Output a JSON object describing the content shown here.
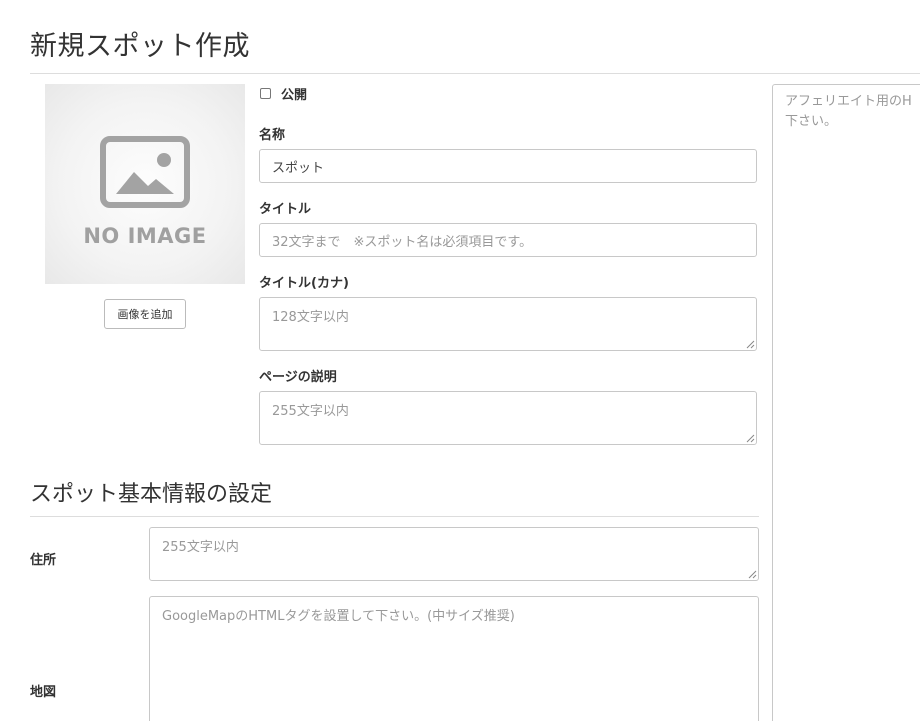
{
  "page": {
    "title": "新規スポット作成"
  },
  "image": {
    "placeholder_text": "NO IMAGE",
    "add_button_label": "画像を追加"
  },
  "form": {
    "publish_label": "公開",
    "publish_checked": false,
    "name": {
      "label": "名称",
      "value": "スポット"
    },
    "title": {
      "label": "タイトル",
      "placeholder": "32文字まで　※スポット名は必須項目です。"
    },
    "title_kana": {
      "label": "タイトル(カナ)",
      "placeholder": "128文字以内"
    },
    "page_description": {
      "label": "ページの説明",
      "placeholder": "255文字以内"
    }
  },
  "basic_info": {
    "section_title": "スポット基本情報の設定",
    "address": {
      "label": "住所",
      "placeholder": "255文字以内"
    },
    "map": {
      "label": "地図",
      "placeholder": "GoogleMapのHTMLタグを設置して下さい。(中サイズ推奨)"
    }
  },
  "affiliate": {
    "placeholder": "アフェリエイト用のH\n下さい。"
  }
}
